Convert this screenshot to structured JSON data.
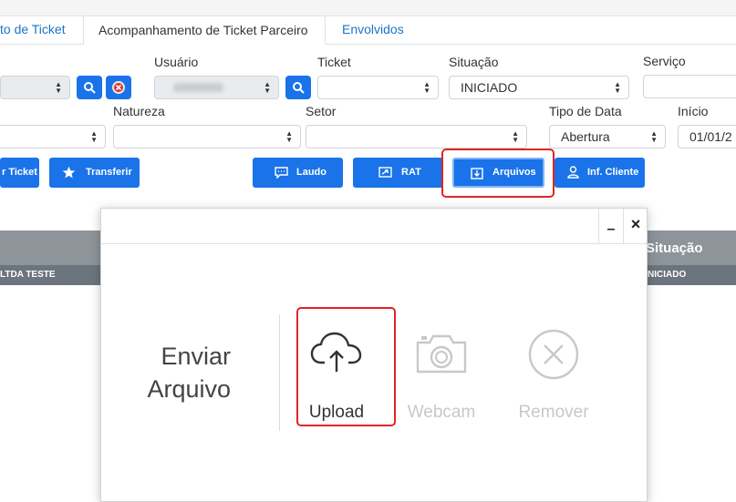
{
  "tabs": [
    {
      "label": "to de Ticket"
    },
    {
      "label": "Acompanhamento de Ticket Parceiro"
    },
    {
      "label": "Envolvidos"
    }
  ],
  "filters": {
    "usuario_label": "Usuário",
    "ticket_label": "Ticket",
    "situacao_label": "Situação",
    "situacao_value": "INICIADO",
    "servico_label": "Serviço",
    "natureza_label": "Natureza",
    "setor_label": "Setor",
    "tipo_data_label": "Tipo de Data",
    "tipo_data_value": "Abertura",
    "inicio_label": "Início",
    "inicio_value": "01/01/2"
  },
  "actions": {
    "ticket_label": "r Ticket",
    "transferir_label": "Transferir",
    "laudo_label": "Laudo",
    "rat_label": "RAT",
    "arquivos_label": "Arquivos",
    "inf_cliente_label": "Inf. Cliente"
  },
  "grid": {
    "situacao_header": "Situação",
    "row_client": "LTDA TESTE",
    "row_status": "NICIADO"
  },
  "modal": {
    "minimize_symbol": "–",
    "close_symbol": "×",
    "title_line1": "Enviar",
    "title_line2": "Arquivo",
    "options": [
      {
        "label": "Upload",
        "icon": "cloud-upload-icon",
        "enabled": true
      },
      {
        "label": "Webcam",
        "icon": "camera-icon",
        "enabled": false
      },
      {
        "label": "Remover",
        "icon": "remove-circle-icon",
        "enabled": false
      }
    ]
  },
  "colors": {
    "primary": "#1a73e8",
    "link": "#1a73c8",
    "highlight": "#e02424",
    "disabled": "#c8c8c8"
  }
}
